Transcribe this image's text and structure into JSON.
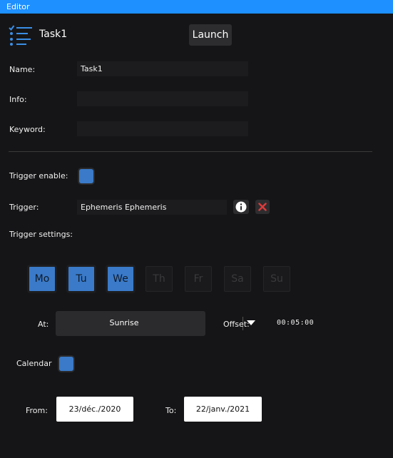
{
  "window": {
    "title": "Editor"
  },
  "header": {
    "task_name": "Task1",
    "launch_label": "Launch",
    "icon": "task-list-icon"
  },
  "form": {
    "name_label": "Name:",
    "name_value": "Task1",
    "info_label": "Info:",
    "info_value": "",
    "keyword_label": "Keyword:",
    "keyword_value": ""
  },
  "trigger": {
    "enable_label": "Trigger enable:",
    "enabled": true,
    "label": "Trigger:",
    "value": "Ephemeris  Ephemeris",
    "settings_label": "Trigger settings:"
  },
  "days": [
    {
      "label": "Mo",
      "on": true
    },
    {
      "label": "Tu",
      "on": true
    },
    {
      "label": "We",
      "on": true
    },
    {
      "label": "Th",
      "on": false
    },
    {
      "label": "Fr",
      "on": false
    },
    {
      "label": "Sa",
      "on": false
    },
    {
      "label": "Su",
      "on": false
    }
  ],
  "at": {
    "label": "At:",
    "value": "Sunrise"
  },
  "offset": {
    "label": "Offset:",
    "value": "00:05:00"
  },
  "calendar": {
    "label": "Calendar",
    "enabled": true
  },
  "range": {
    "from_label": "From:",
    "from_value": "23/déc./2020",
    "to_label": "To:",
    "to_value": "22/janv./2021"
  },
  "colors": {
    "accent": "#1e90ff",
    "check": "#3a7ac8",
    "background": "#151517",
    "delete": "#e03a3a"
  }
}
